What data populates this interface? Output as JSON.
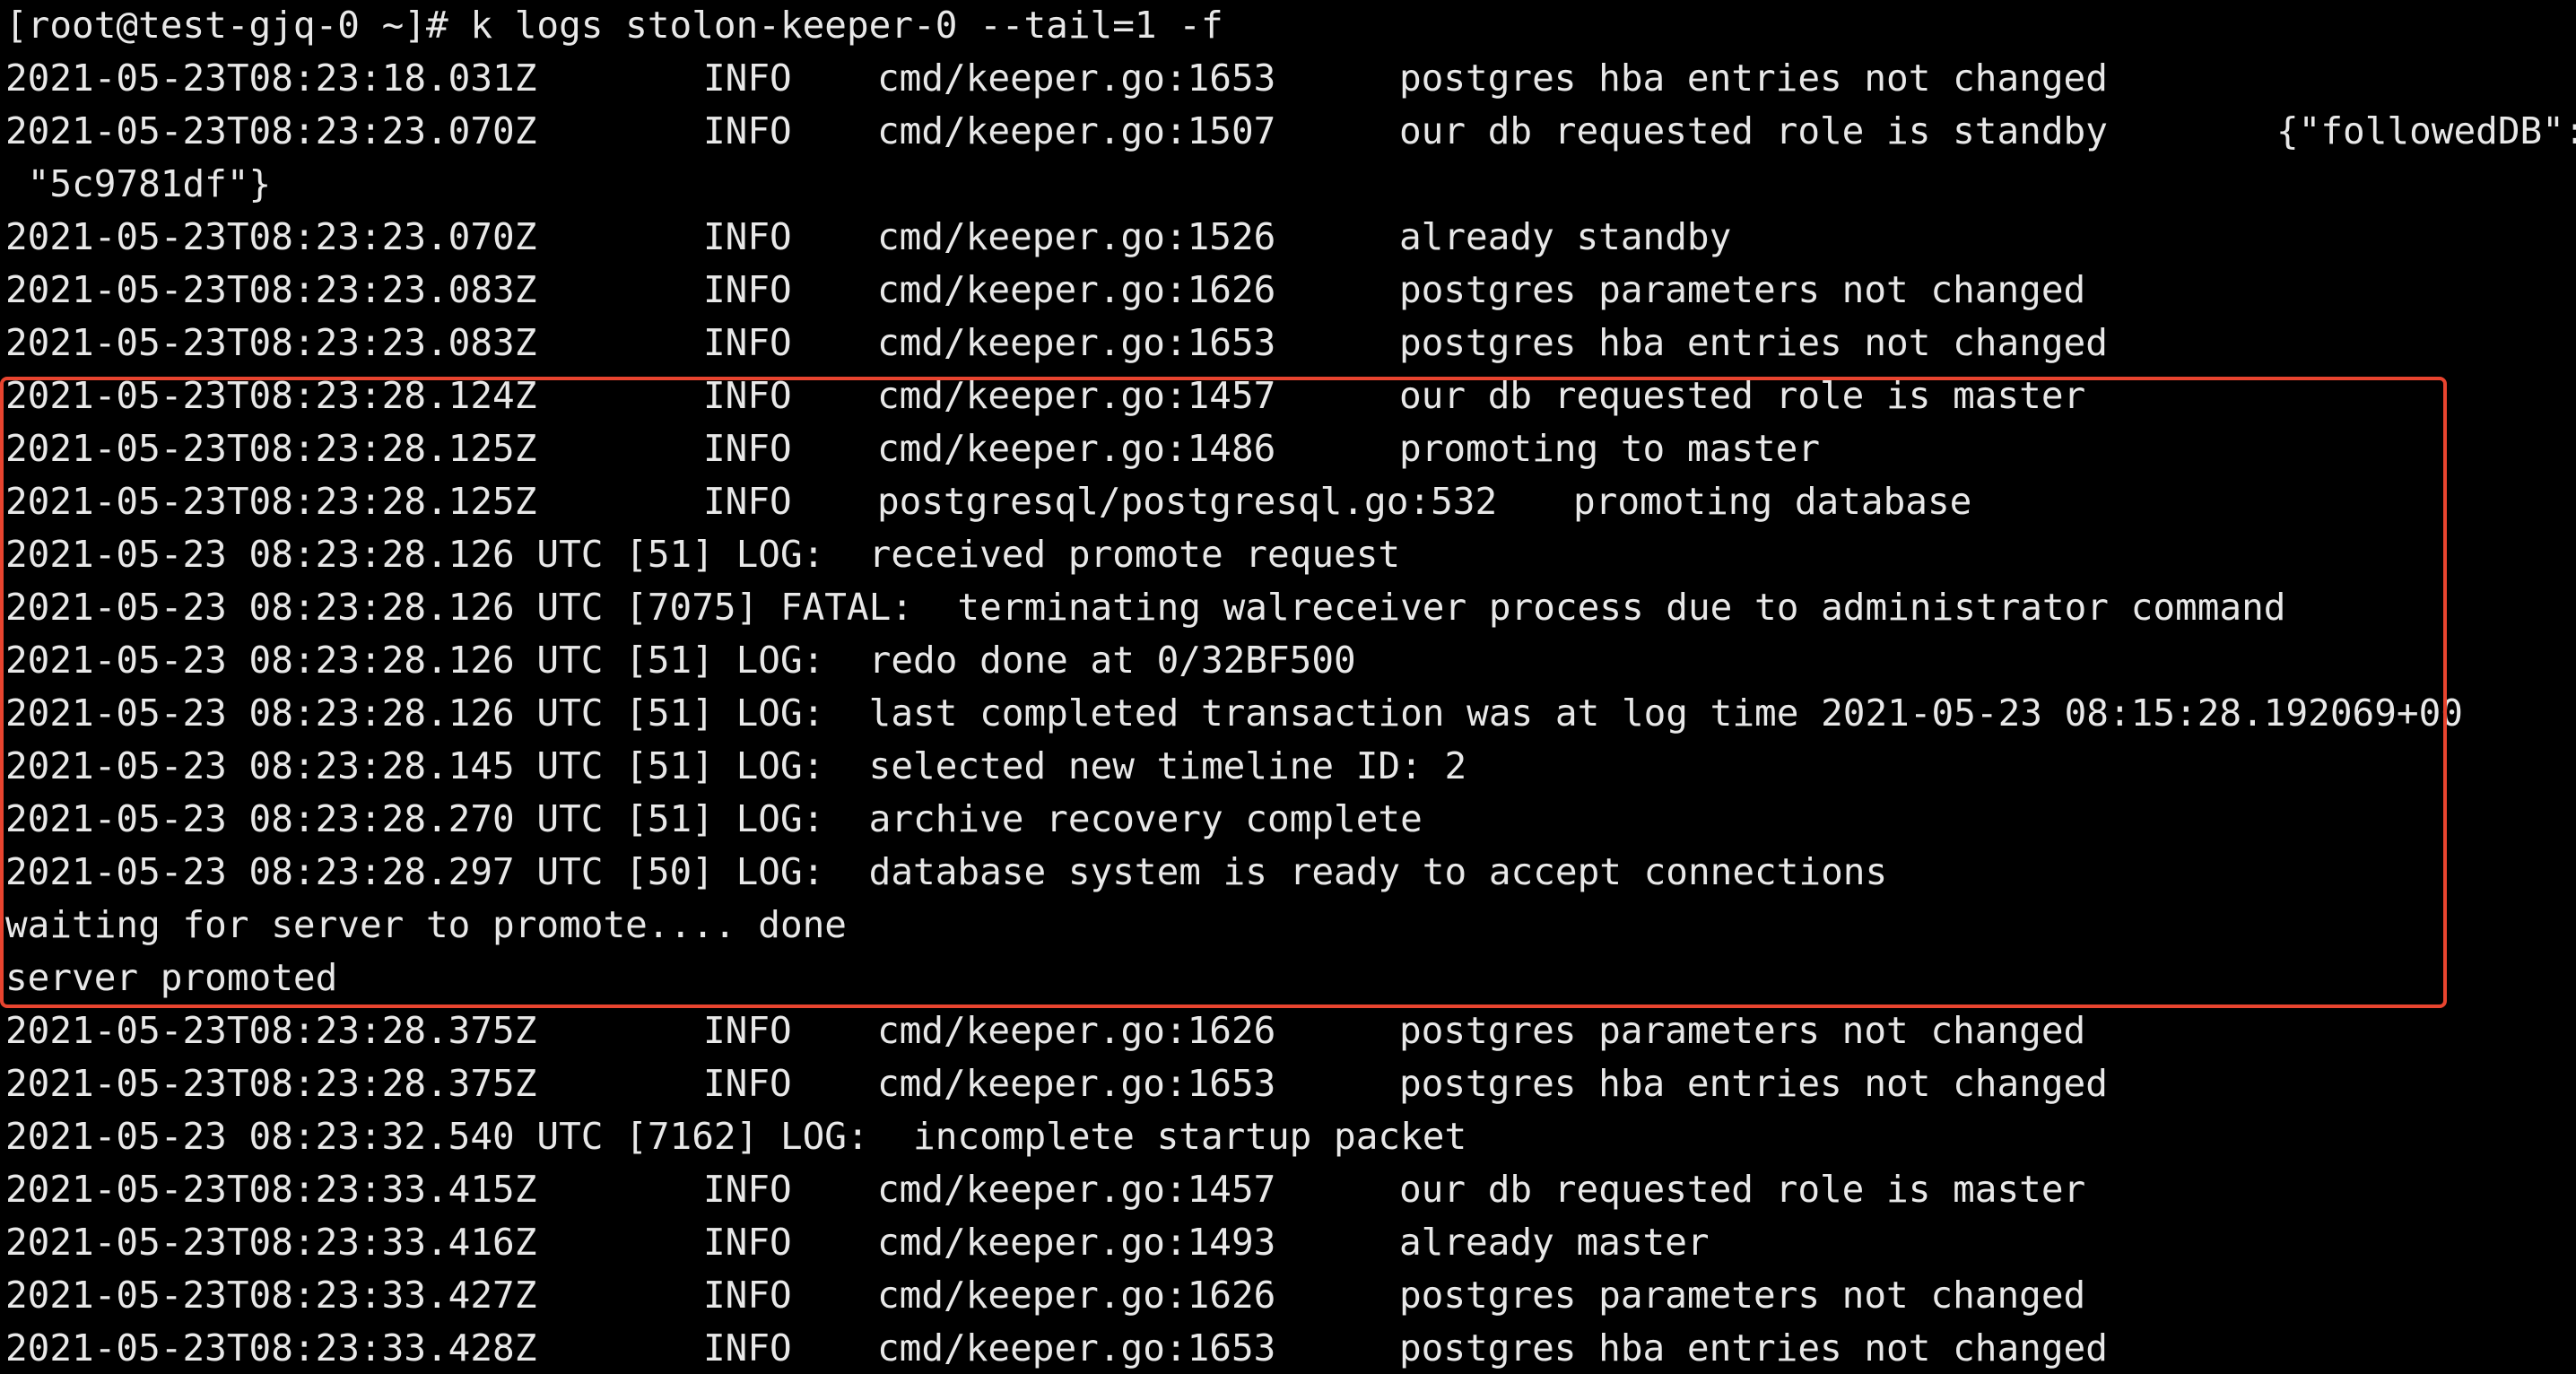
{
  "terminal": {
    "prompt_line": "[root@test-gjq-0 ~]# k logs stolon-keeper-0 --tail=1 -f",
    "highlight_color": "#e8442f",
    "lines": [
      {
        "type": "keeper",
        "ts": "2021-05-23T08:23:18.031Z",
        "level": "INFO",
        "src": "cmd/keeper.go:1653",
        "msg": "postgres hba entries not changed"
      },
      {
        "type": "keeper",
        "ts": "2021-05-23T08:23:23.070Z",
        "level": "INFO",
        "src": "cmd/keeper.go:1507",
        "msg": "our db requested role is standby",
        "json": "{\"followedDB\":"
      },
      {
        "type": "raw",
        "text": " \"5c9781df\"}"
      },
      {
        "type": "keeper",
        "ts": "2021-05-23T08:23:23.070Z",
        "level": "INFO",
        "src": "cmd/keeper.go:1526",
        "msg": "already standby"
      },
      {
        "type": "keeper",
        "ts": "2021-05-23T08:23:23.083Z",
        "level": "INFO",
        "src": "cmd/keeper.go:1626",
        "msg": "postgres parameters not changed"
      },
      {
        "type": "keeper",
        "ts": "2021-05-23T08:23:23.083Z",
        "level": "INFO",
        "src": "cmd/keeper.go:1653",
        "msg": "postgres hba entries not changed"
      },
      {
        "type": "keeper",
        "ts": "2021-05-23T08:23:28.124Z",
        "level": "INFO",
        "src": "cmd/keeper.go:1457",
        "msg": "our db requested role is master"
      },
      {
        "type": "keeper",
        "ts": "2021-05-23T08:23:28.125Z",
        "level": "INFO",
        "src": "cmd/keeper.go:1486",
        "msg": "promoting to master"
      },
      {
        "type": "keeper",
        "ts": "2021-05-23T08:23:28.125Z",
        "level": "INFO",
        "src": "postgresql/postgresql.go:532",
        "msg": "promoting database",
        "wide": true
      },
      {
        "type": "raw",
        "text": "2021-05-23 08:23:28.126 UTC [51] LOG:  received promote request"
      },
      {
        "type": "raw",
        "text": "2021-05-23 08:23:28.126 UTC [7075] FATAL:  terminating walreceiver process due to administrator command"
      },
      {
        "type": "raw",
        "text": "2021-05-23 08:23:28.126 UTC [51] LOG:  redo done at 0/32BF500"
      },
      {
        "type": "raw",
        "text": "2021-05-23 08:23:28.126 UTC [51] LOG:  last completed transaction was at log time 2021-05-23 08:15:28.192069+00"
      },
      {
        "type": "raw",
        "text": "2021-05-23 08:23:28.145 UTC [51] LOG:  selected new timeline ID: 2"
      },
      {
        "type": "raw",
        "text": "2021-05-23 08:23:28.270 UTC [51] LOG:  archive recovery complete"
      },
      {
        "type": "raw",
        "text": "2021-05-23 08:23:28.297 UTC [50] LOG:  database system is ready to accept connections"
      },
      {
        "type": "raw",
        "text": "waiting for server to promote.... done"
      },
      {
        "type": "raw",
        "text": "server promoted"
      },
      {
        "type": "keeper",
        "ts": "2021-05-23T08:23:28.375Z",
        "level": "INFO",
        "src": "cmd/keeper.go:1626",
        "msg": "postgres parameters not changed"
      },
      {
        "type": "keeper",
        "ts": "2021-05-23T08:23:28.375Z",
        "level": "INFO",
        "src": "cmd/keeper.go:1653",
        "msg": "postgres hba entries not changed"
      },
      {
        "type": "raw",
        "text": "2021-05-23 08:23:32.540 UTC [7162] LOG:  incomplete startup packet"
      },
      {
        "type": "keeper",
        "ts": "2021-05-23T08:23:33.415Z",
        "level": "INFO",
        "src": "cmd/keeper.go:1457",
        "msg": "our db requested role is master"
      },
      {
        "type": "keeper",
        "ts": "2021-05-23T08:23:33.416Z",
        "level": "INFO",
        "src": "cmd/keeper.go:1493",
        "msg": "already master"
      },
      {
        "type": "keeper",
        "ts": "2021-05-23T08:23:33.427Z",
        "level": "INFO",
        "src": "cmd/keeper.go:1626",
        "msg": "postgres parameters not changed"
      },
      {
        "type": "keeper",
        "ts": "2021-05-23T08:23:33.428Z",
        "level": "INFO",
        "src": "cmd/keeper.go:1653",
        "msg": "postgres hba entries not changed"
      }
    ]
  }
}
